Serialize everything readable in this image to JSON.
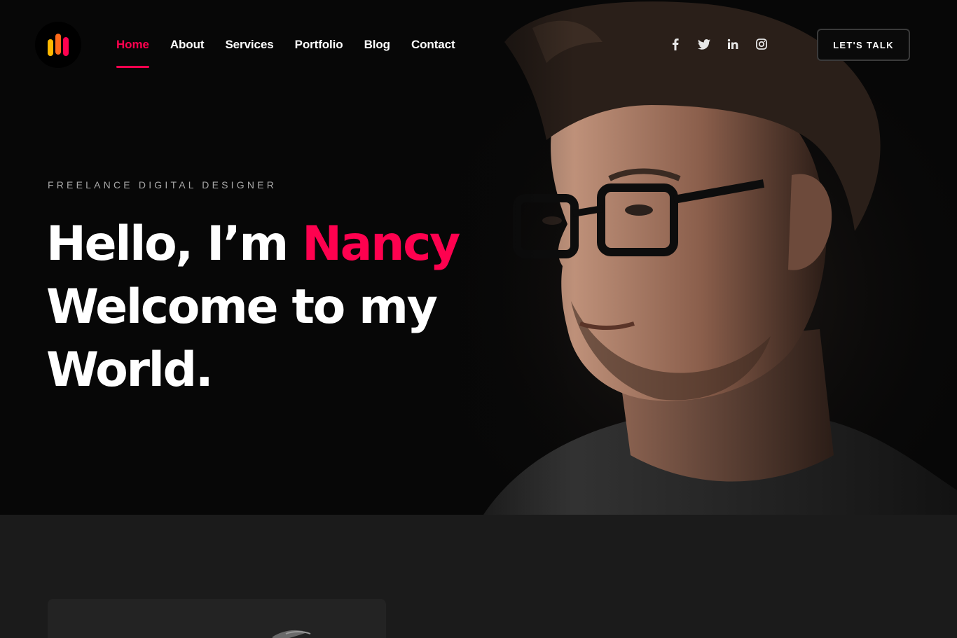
{
  "header": {
    "nav": [
      {
        "label": "Home",
        "active": true
      },
      {
        "label": "About"
      },
      {
        "label": "Services"
      },
      {
        "label": "Portfolio"
      },
      {
        "label": "Blog"
      },
      {
        "label": "Contact"
      }
    ],
    "social": [
      "facebook-icon",
      "twitter-icon",
      "linkedin-icon",
      "instagram-icon"
    ],
    "cta_label": "LET'S TALK"
  },
  "hero": {
    "subtitle": "FREELANCE DIGITAL DESIGNER",
    "greeting": "Hello, I’m",
    "name": "Nancy",
    "line2": "Welcome to my",
    "line3": "World."
  },
  "colors": {
    "accent": "#ff014f",
    "background": "#070707",
    "section_bg": "#1b1b1b"
  }
}
